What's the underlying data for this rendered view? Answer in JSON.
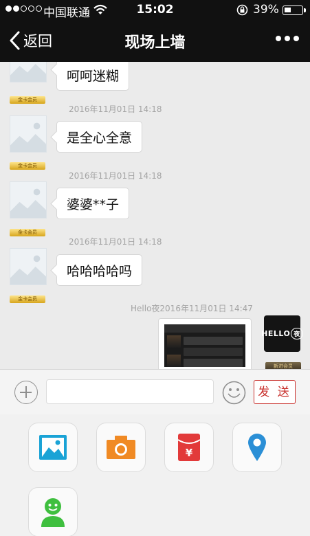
{
  "status_bar": {
    "carrier": "中国联通",
    "time": "15:02",
    "battery": "39%",
    "battery_level": 0.39,
    "signal_bars_filled": 2,
    "signal_bars_total": 5
  },
  "nav": {
    "back_label": "返回",
    "title": "现场上墙"
  },
  "messages": [
    {
      "text": "呵呵迷糊",
      "badge": "金卡会员"
    },
    {
      "meta": "2016年11月01日 14:18",
      "text": "是全心全意",
      "badge": "金卡会员"
    },
    {
      "meta": "2016年11月01日 14:18",
      "text": "婆婆**子",
      "badge": "金卡会员"
    },
    {
      "meta": "2016年11月01日 14:18",
      "text": "哈哈哈哈吗",
      "badge": "金卡会员"
    }
  ],
  "self_message": {
    "meta": "Hello夜2016年11月01日 14:47",
    "avatar_text": "HELLO",
    "avatar_ring": "夜",
    "badge": "新进会员"
  },
  "composer": {
    "input_value": "",
    "send_label": "发 送"
  },
  "tools": [
    {
      "icon": "image-icon"
    },
    {
      "icon": "camera-icon"
    },
    {
      "icon": "red-packet-icon"
    },
    {
      "icon": "location-icon"
    },
    {
      "icon": "contact-icon"
    }
  ],
  "colors": {
    "bar": "#111111",
    "send_red": "#c9302c",
    "image_blue": "#1aa3d6",
    "camera_orange": "#f08a24",
    "packet_red": "#e23a3a",
    "location_blue": "#2b8fd6",
    "contact_green": "#3fbf3f"
  }
}
